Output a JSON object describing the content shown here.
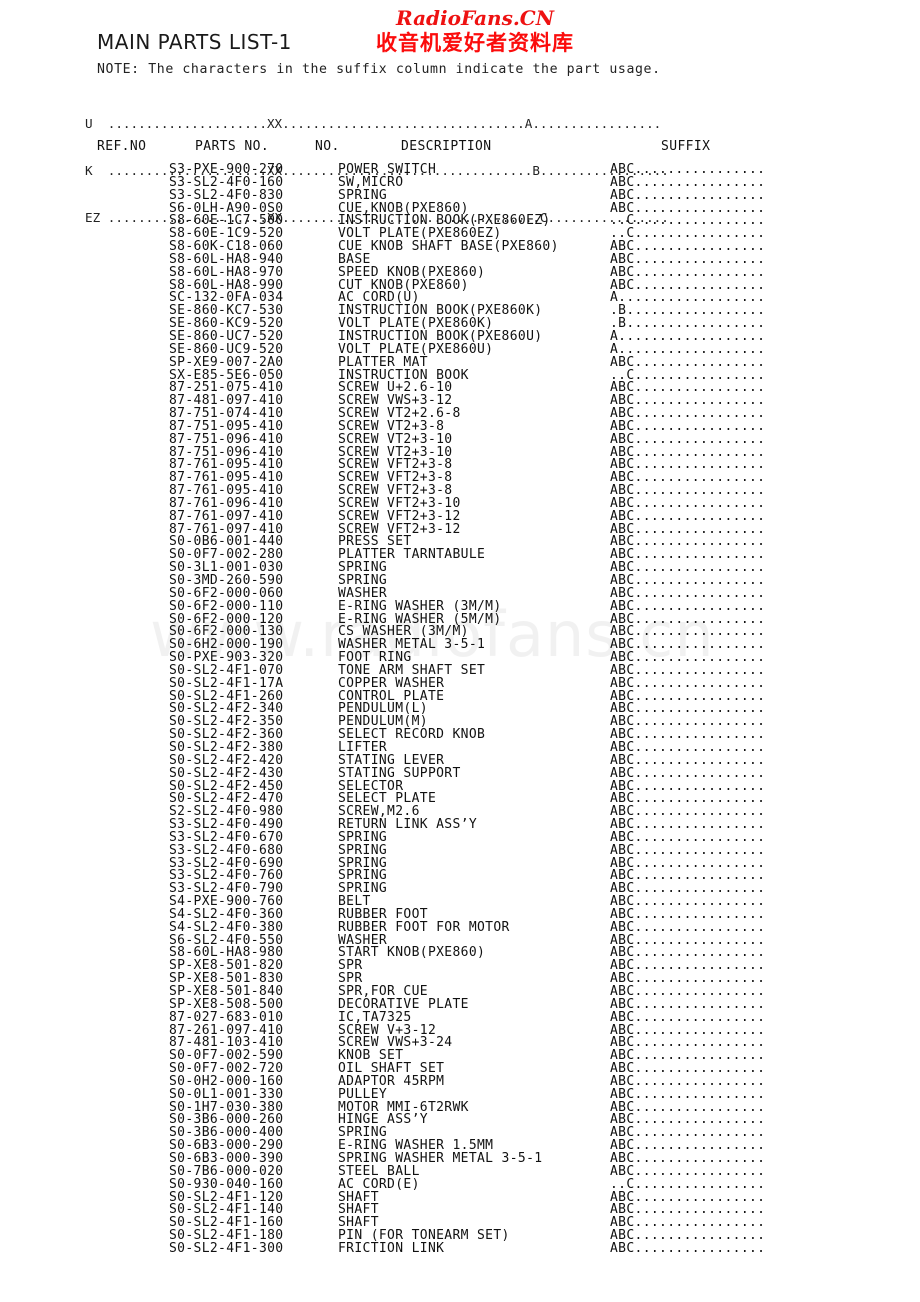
{
  "document": {
    "title": "MAIN PARTS LIST-1",
    "note": "NOTE: The characters in the suffix column indicate the part usage."
  },
  "watermarks": {
    "brand_latin": "RadioFans.CN",
    "brand_cjk": "收音机爱好者资料库",
    "brand_color": "#ee1111",
    "url": "www.radiofans.cn",
    "url_color": "rgba(0,0,0,0.055)"
  },
  "legend": [
    "U  .....................XX................................A.................",
    "K  .....................XX.................................B.................",
    "EZ .....................XX..................................C................"
  ],
  "columns": {
    "ref_no": "REF.NO",
    "parts_no": "PARTS NO.",
    "no": "NO.",
    "description": "DESCRIPTION",
    "suffix": "SUFFIX"
  },
  "rows": [
    {
      "ref": "",
      "part": "S3-PXE-900-270",
      "desc": "POWER SWITCH",
      "suffix": "ABC................"
    },
    {
      "ref": "",
      "part": "S3-SL2-4F0-160",
      "desc": "SW,MICRO",
      "suffix": "ABC................"
    },
    {
      "ref": "",
      "part": "S3-SL2-4F0-830",
      "desc": "SPRING",
      "suffix": "ABC................"
    },
    {
      "ref": "",
      "part": "S6-0LH-A90-0S0",
      "desc": "CUE,KNOB(PXE860)",
      "suffix": "ABC................"
    },
    {
      "ref": "",
      "part": "S8-60E-1C7-500",
      "desc": "INSTRUCTION BOOK(PXE860EZ)",
      "suffix": "..C................"
    },
    {
      "ref": "",
      "part": "S8-60E-1C9-520",
      "desc": "VOLT PLATE(PXE860EZ)",
      "suffix": "..C................"
    },
    {
      "ref": "",
      "part": "S8-60K-C18-060",
      "desc": "CUE KNOB SHAFT BASE(PXE860)",
      "suffix": "ABC................"
    },
    {
      "ref": "",
      "part": "S8-60L-HA8-940",
      "desc": "BASE",
      "suffix": "ABC................"
    },
    {
      "ref": "",
      "part": "S8-60L-HA8-970",
      "desc": "SPEED KNOB(PXE860)",
      "suffix": "ABC................"
    },
    {
      "ref": "",
      "part": "S8-60L-HA8-990",
      "desc": "CUT KNOB(PXE860)",
      "suffix": "ABC................"
    },
    {
      "ref": "",
      "part": "SC-132-0FA-034",
      "desc": "AC CORD(U)",
      "suffix": "A.................."
    },
    {
      "ref": "",
      "part": "SE-860-KC7-530",
      "desc": "INSTRUCTION BOOK(PXE860K)",
      "suffix": ".B................."
    },
    {
      "ref": "",
      "part": "SE-860-KC9-520",
      "desc": "VOLT PLATE(PXE860K)",
      "suffix": ".B................."
    },
    {
      "ref": "",
      "part": "SE-860-UC7-520",
      "desc": "INSTRUCTION BOOK(PXE860U)",
      "suffix": "A.................."
    },
    {
      "ref": "",
      "part": "SE-860-UC9-520",
      "desc": "VOLT PLATE(PXE860U)",
      "suffix": "A.................."
    },
    {
      "ref": "",
      "part": "SP-XE9-007-2A0",
      "desc": "PLATTER MAT",
      "suffix": "ABC................"
    },
    {
      "ref": "",
      "part": "SX-E85-5E6-050",
      "desc": "INSTRUCTION BOOK",
      "suffix": "..C................"
    },
    {
      "ref": "",
      "part": "87-251-075-410",
      "desc": "SCREW U+2.6-10",
      "suffix": "ABC................"
    },
    {
      "ref": "",
      "part": "87-481-097-410",
      "desc": "SCREW VWS+3-12",
      "suffix": "ABC................"
    },
    {
      "ref": "",
      "part": "87-751-074-410",
      "desc": "SCREW VT2+2.6-8",
      "suffix": "ABC................"
    },
    {
      "ref": "",
      "part": "87-751-095-410",
      "desc": "SCREW VT2+3-8",
      "suffix": "ABC................"
    },
    {
      "ref": "",
      "part": "87-751-096-410",
      "desc": "SCREW VT2+3-10",
      "suffix": "ABC................"
    },
    {
      "ref": "",
      "part": "87-751-096-410",
      "desc": "SCREW VT2+3-10",
      "suffix": "ABC................"
    },
    {
      "ref": "",
      "part": "87-761-095-410",
      "desc": "SCREW VFT2+3-8",
      "suffix": "ABC................"
    },
    {
      "ref": "",
      "part": "87-761-095-410",
      "desc": "SCREW VFT2+3-8",
      "suffix": "ABC................"
    },
    {
      "ref": "",
      "part": "87-761-095-410",
      "desc": "SCREW VFT2+3-8",
      "suffix": "ABC................"
    },
    {
      "ref": "",
      "part": "87-761-096-410",
      "desc": "SCREW VFT2+3-10",
      "suffix": "ABC................"
    },
    {
      "ref": "",
      "part": "87-761-097-410",
      "desc": "SCREW VFT2+3-12",
      "suffix": "ABC................"
    },
    {
      "ref": "",
      "part": "87-761-097-410",
      "desc": "SCREW VFT2+3-12",
      "suffix": "ABC................"
    },
    {
      "ref": "",
      "part": "S0-0B6-001-440",
      "desc": "PRESS SET",
      "suffix": "ABC................"
    },
    {
      "ref": "",
      "part": "S0-0F7-002-280",
      "desc": "PLATTER TARNTABULE",
      "suffix": "ABC................"
    },
    {
      "ref": "",
      "part": "S0-3L1-001-030",
      "desc": "SPRING",
      "suffix": "ABC................"
    },
    {
      "ref": "",
      "part": "S0-3MD-260-590",
      "desc": "SPRING",
      "suffix": "ABC................"
    },
    {
      "ref": "",
      "part": "S0-6F2-000-060",
      "desc": "WASHER",
      "suffix": "ABC................"
    },
    {
      "ref": "",
      "part": "S0-6F2-000-110",
      "desc": "E-RING WASHER (3M/M)",
      "suffix": "ABC................"
    },
    {
      "ref": "",
      "part": "S0-6F2-000-120",
      "desc": "E-RING WASHER (5M/M)",
      "suffix": "ABC................"
    },
    {
      "ref": "",
      "part": "S0-6F2-000-130",
      "desc": "CS WASHER (3M/M)",
      "suffix": "ABC................"
    },
    {
      "ref": "",
      "part": "S0-6H2-000-190",
      "desc": "WASHER METAL 3-5-1",
      "suffix": "ABC................"
    },
    {
      "ref": "",
      "part": "S0-PXE-903-320",
      "desc": "FOOT RING",
      "suffix": "ABC................"
    },
    {
      "ref": "",
      "part": "S0-SL2-4F1-070",
      "desc": "TONE ARM SHAFT SET",
      "suffix": "ABC................"
    },
    {
      "ref": "",
      "part": "S0-SL2-4F1-17A",
      "desc": "COPPER WASHER",
      "suffix": "ABC................"
    },
    {
      "ref": "",
      "part": "S0-SL2-4F1-260",
      "desc": "CONTROL PLATE",
      "suffix": "ABC................"
    },
    {
      "ref": "",
      "part": "S0-SL2-4F2-340",
      "desc": "PENDULUM(L)",
      "suffix": "ABC................"
    },
    {
      "ref": "",
      "part": "S0-SL2-4F2-350",
      "desc": "PENDULUM(M)",
      "suffix": "ABC................"
    },
    {
      "ref": "",
      "part": "S0-SL2-4F2-360",
      "desc": "SELECT RECORD KNOB",
      "suffix": "ABC................"
    },
    {
      "ref": "",
      "part": "S0-SL2-4F2-380",
      "desc": "LIFTER",
      "suffix": "ABC................"
    },
    {
      "ref": "",
      "part": "S0-SL2-4F2-420",
      "desc": "STATING LEVER",
      "suffix": "ABC................"
    },
    {
      "ref": "",
      "part": "S0-SL2-4F2-430",
      "desc": "STATING SUPPORT",
      "suffix": "ABC................"
    },
    {
      "ref": "",
      "part": "S0-SL2-4F2-450",
      "desc": "SELECTOR",
      "suffix": "ABC................"
    },
    {
      "ref": "",
      "part": "S0-SL2-4F2-470",
      "desc": "SELECT PLATE",
      "suffix": "ABC................"
    },
    {
      "ref": "",
      "part": "S2-SL2-4F0-980",
      "desc": "SCREW,M2.6",
      "suffix": "ABC................"
    },
    {
      "ref": "",
      "part": "S3-SL2-4F0-490",
      "desc": "RETURN LINK ASS’Y",
      "suffix": "ABC................"
    },
    {
      "ref": "",
      "part": "S3-SL2-4F0-670",
      "desc": "SPRING",
      "suffix": "ABC................"
    },
    {
      "ref": "",
      "part": "S3-SL2-4F0-680",
      "desc": "SPRING",
      "suffix": "ABC................"
    },
    {
      "ref": "",
      "part": "S3-SL2-4F0-690",
      "desc": "SPRING",
      "suffix": "ABC................"
    },
    {
      "ref": "",
      "part": "S3-SL2-4F0-760",
      "desc": "SPRING",
      "suffix": "ABC................"
    },
    {
      "ref": "",
      "part": "S3-SL2-4F0-790",
      "desc": "SPRING",
      "suffix": "ABC................"
    },
    {
      "ref": "",
      "part": "S4-PXE-900-760",
      "desc": "BELT",
      "suffix": "ABC................"
    },
    {
      "ref": "",
      "part": "S4-SL2-4F0-360",
      "desc": "RUBBER FOOT",
      "suffix": "ABC................"
    },
    {
      "ref": "",
      "part": "S4-SL2-4F0-380",
      "desc": "RUBBER FOOT FOR MOTOR",
      "suffix": "ABC................"
    },
    {
      "ref": "",
      "part": "S6-SL2-4F0-550",
      "desc": "WASHER",
      "suffix": "ABC................"
    },
    {
      "ref": "",
      "part": "S8-60L-HA8-980",
      "desc": "START KNOB(PXE860)",
      "suffix": "ABC................"
    },
    {
      "ref": "",
      "part": "SP-XE8-501-820",
      "desc": "SPR",
      "suffix": "ABC................"
    },
    {
      "ref": "",
      "part": "SP-XE8-501-830",
      "desc": "SPR",
      "suffix": "ABC................"
    },
    {
      "ref": "",
      "part": "SP-XE8-501-840",
      "desc": "SPR,FOR CUE",
      "suffix": "ABC................"
    },
    {
      "ref": "",
      "part": "SP-XE8-508-500",
      "desc": "DECORATIVE PLATE",
      "suffix": "ABC................"
    },
    {
      "ref": "",
      "part": "87-027-683-010",
      "desc": "IC,TA7325",
      "suffix": "ABC................"
    },
    {
      "ref": "",
      "part": "87-261-097-410",
      "desc": "SCREW V+3-12",
      "suffix": "ABC................"
    },
    {
      "ref": "",
      "part": "87-481-103-410",
      "desc": "SCREW VWS+3-24",
      "suffix": "ABC................"
    },
    {
      "ref": "",
      "part": "S0-0F7-002-590",
      "desc": "KNOB SET",
      "suffix": "ABC................"
    },
    {
      "ref": "",
      "part": "S0-0F7-002-720",
      "desc": "OIL SHAFT SET",
      "suffix": "ABC................"
    },
    {
      "ref": "",
      "part": "S0-0H2-000-160",
      "desc": "ADAPTOR 45RPM",
      "suffix": "ABC................"
    },
    {
      "ref": "",
      "part": "S0-0L1-001-330",
      "desc": "PULLEY",
      "suffix": "ABC................"
    },
    {
      "ref": "",
      "part": "S0-1H7-030-380",
      "desc": "MOTOR MMI-6T2RWK",
      "suffix": "ABC................"
    },
    {
      "ref": "",
      "part": "S0-3B6-000-260",
      "desc": "HINGE ASS’Y",
      "suffix": "ABC................"
    },
    {
      "ref": "",
      "part": "S0-3B6-000-400",
      "desc": "SPRING",
      "suffix": "ABC................"
    },
    {
      "ref": "",
      "part": "S0-6B3-000-290",
      "desc": "E-RING WASHER 1.5MM",
      "suffix": "ABC................"
    },
    {
      "ref": "",
      "part": "S0-6B3-000-390",
      "desc": "SPRING WASHER METAL 3-5-1",
      "suffix": "ABC................"
    },
    {
      "ref": "",
      "part": "S0-7B6-000-020",
      "desc": "STEEL BALL",
      "suffix": "ABC................"
    },
    {
      "ref": "",
      "part": "S0-930-040-160",
      "desc": "AC CORD(E)",
      "suffix": "..C................"
    },
    {
      "ref": "",
      "part": "S0-SL2-4F1-120",
      "desc": "SHAFT",
      "suffix": "ABC................"
    },
    {
      "ref": "",
      "part": "S0-SL2-4F1-140",
      "desc": "SHAFT",
      "suffix": "ABC................"
    },
    {
      "ref": "",
      "part": "S0-SL2-4F1-160",
      "desc": "SHAFT",
      "suffix": "ABC................"
    },
    {
      "ref": "",
      "part": "S0-SL2-4F1-180",
      "desc": "PIN (FOR TONEARM SET)",
      "suffix": "ABC................"
    },
    {
      "ref": "",
      "part": "S0-SL2-4F1-300",
      "desc": "FRICTION LINK",
      "suffix": "ABC................"
    }
  ]
}
